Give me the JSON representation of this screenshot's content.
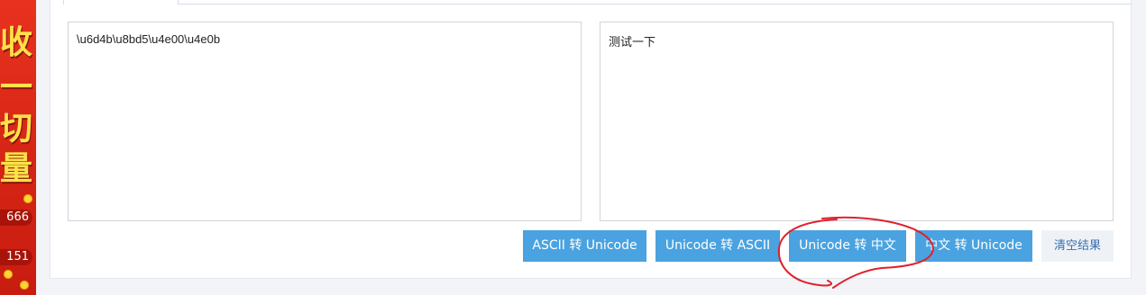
{
  "banner": {
    "glyphs": [
      "收",
      "一",
      "切",
      "量"
    ],
    "pill_1": "666",
    "pill_2": "151"
  },
  "converter": {
    "input_text": "\\u6d4b\\u8bd5\\u4e00\\u4e0b",
    "output_text": "测试一下"
  },
  "buttons": {
    "ascii_to_unicode": "ASCII 转 Unicode",
    "unicode_to_ascii": "Unicode 转 ASCII",
    "unicode_to_chinese": "Unicode 转 中文",
    "chinese_to_unicode": "中文 转 Unicode",
    "clear": "清空结果"
  },
  "colors": {
    "button_blue": "#4aa3e0",
    "annotation_red": "#e0212b",
    "banner_red": "#d42414"
  }
}
